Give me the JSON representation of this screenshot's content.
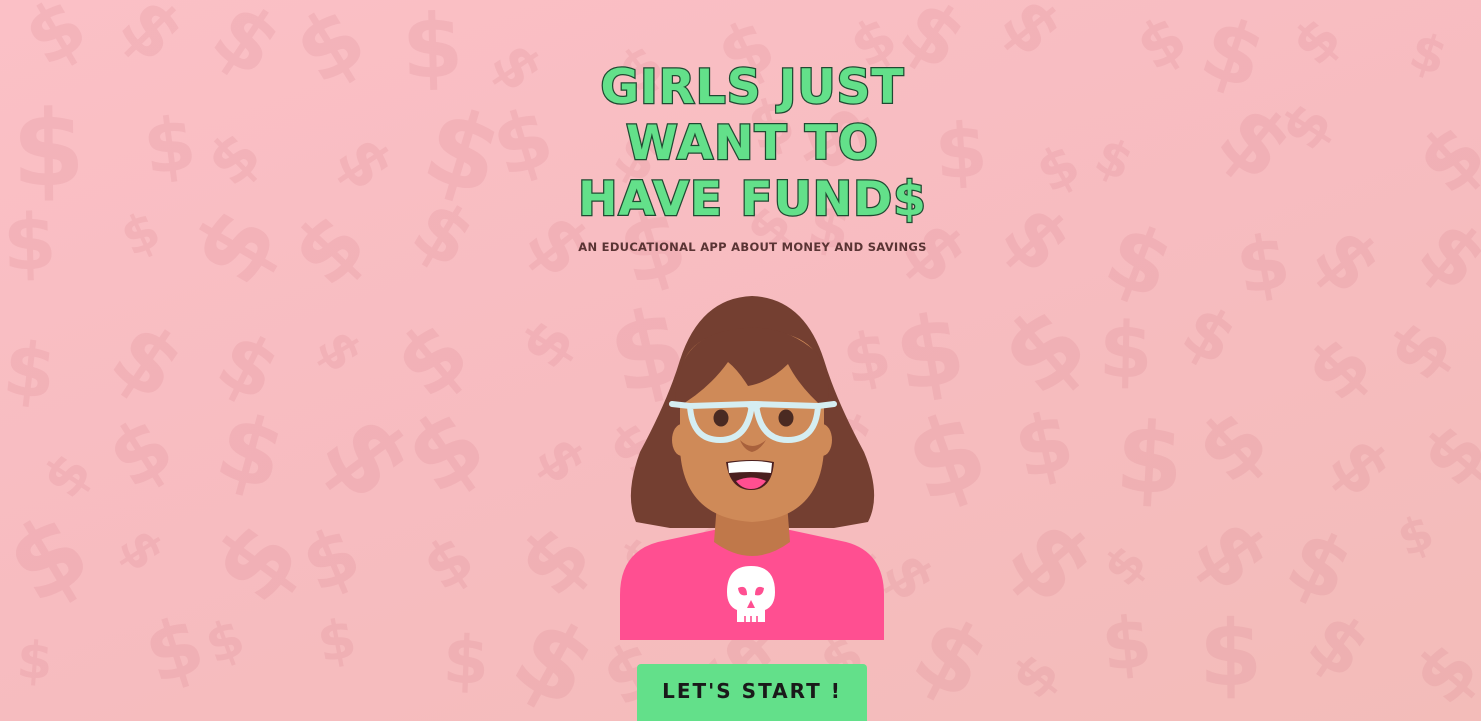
{
  "hero": {
    "title_lines": [
      "GIRLS JUST",
      "WANT TO",
      "HAVE FUND$"
    ],
    "subtitle": "AN EDUCATIONAL APP ABOUT MONEY AND SAVINGS"
  },
  "avatar": {
    "description_icon": "girl-with-glasses-avatar",
    "shirt_icon": "skull-icon"
  },
  "cta": {
    "label": "LET'S START !"
  },
  "background": {
    "pattern_glyph": "$",
    "pattern_icon": "dollar-sign-icon"
  },
  "colors": {
    "background_pink": "#f8bdc2",
    "title_green": "#63e08a",
    "title_outline": "#1f4a31",
    "button_green": "#63e08a",
    "shirt_pink": "#ff4f91",
    "hair_brown": "#743f31",
    "skin": "#cf8a58"
  }
}
